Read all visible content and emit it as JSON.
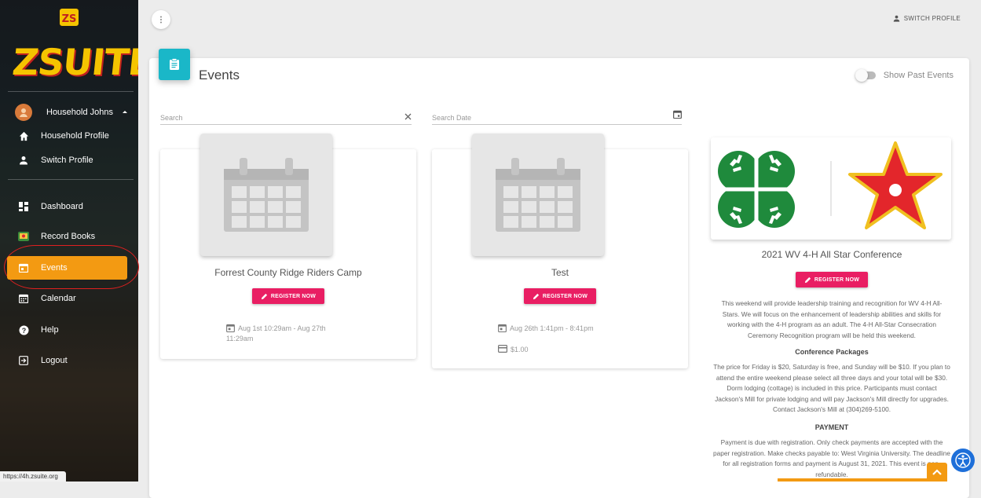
{
  "sidebar": {
    "logo_mark": "ZS",
    "logo_text": "ZSUITE",
    "user": {
      "name": "Household Johns"
    },
    "items": [
      {
        "label": "Household Profile",
        "icon": "home-icon"
      },
      {
        "label": "Switch Profile",
        "icon": "person-icon"
      },
      {
        "label": "Dashboard",
        "icon": "dashboard-icon"
      },
      {
        "label": "Record Books",
        "icon": "record-books-icon"
      },
      {
        "label": "Events",
        "icon": "events-icon",
        "active": true
      },
      {
        "label": "Calendar",
        "icon": "calendar-icon"
      },
      {
        "label": "Help",
        "icon": "help-icon"
      },
      {
        "label": "Logout",
        "icon": "logout-icon"
      }
    ]
  },
  "status_url": "https://4h.zsuite.org",
  "topbar": {
    "menu_icon": "more-vert-icon",
    "switch_profile_label": "SWITCH PROFILE"
  },
  "page": {
    "title": "Events",
    "show_past_events_label": "Show Past Events",
    "search": {
      "placeholder": "Search",
      "clear_icon": "close-icon"
    },
    "search_date": {
      "placeholder": "Search Date",
      "icon": "calendar-icon"
    }
  },
  "events": [
    {
      "title": "Forrest County Ridge Riders Camp",
      "register_label": "REGISTER NOW",
      "date_line1": "Aug 1st 10:29am - Aug 27th",
      "date_line2": "11:29am"
    },
    {
      "title": "Test",
      "register_label": "REGISTER NOW",
      "date_line1": "Aug 26th 1:41pm - 8:41pm",
      "price": "$1.00"
    }
  ],
  "conference": {
    "title": "2021 WV 4-H All Star Conference",
    "register_label": "REGISTER NOW",
    "description": "This weekend will provide leadership training and recognition for WV 4-H All-Stars. We will focus on the enhancement of leadership abilities and skills for working with the 4-H program as an adult. The 4-H All-Star Consecration Ceremony Recognition program will be held this weekend.",
    "packages_heading": "Conference Packages",
    "packages_text": "The price for Friday is $20, Saturday is free, and Sunday will be $10. If you plan to attend the entire weekend please select all three days and your total will be $30. Dorm lodging (cottage) is included in this price. Participants must contact Jackson's Mill for private lodging and will pay Jackson's Mill directly for upgrades. Contact Jackson's Mill at (304)269-5100.",
    "payment_heading": "PAYMENT",
    "payment_text": "Payment is due with registration. Only check payments are accepted with the paper registration. Make checks payable to: West Virginia University. The deadline for all registration forms and payment is August 31, 2021. This event is non-refundable."
  },
  "colors": {
    "accent": "#f39a12",
    "register": "#e91e63",
    "header_icon": "#1ab7c8",
    "clover_green": "#1f8a3c",
    "star_red": "#e3262b"
  }
}
